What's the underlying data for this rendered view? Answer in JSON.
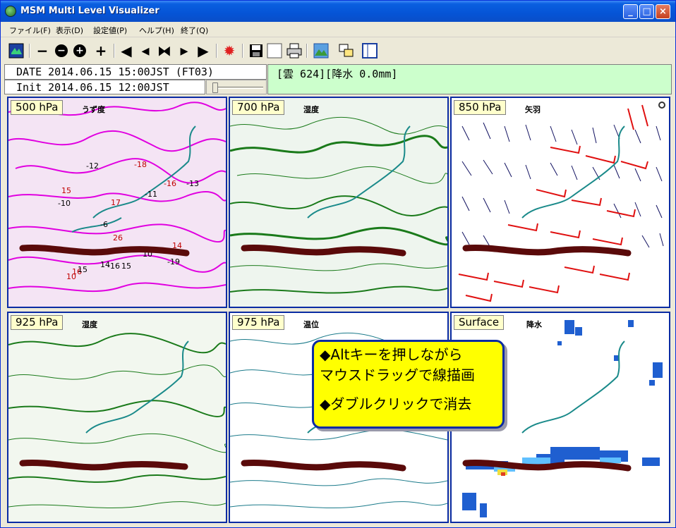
{
  "window": {
    "title": "MSM Multi Level Visualizer",
    "controls": [
      "_",
      "□",
      "×"
    ]
  },
  "menu": {
    "items": [
      "ファイル(F)",
      "表示(D)",
      "設定値(P)",
      "ヘルプ(H)",
      "終了(Q)"
    ]
  },
  "toolbar": {
    "tools": [
      {
        "name": "map-icon"
      },
      {
        "name": "zoom-out-small",
        "glyph": "−"
      },
      {
        "name": "zoom-out",
        "glyph": "−"
      },
      {
        "name": "zoom-in",
        "glyph": "+"
      },
      {
        "name": "zoom-in-small",
        "glyph": "+"
      },
      {
        "name": "first",
        "glyph": "◀"
      },
      {
        "name": "prev",
        "glyph": "◂"
      },
      {
        "name": "stop",
        "glyph": "⧓"
      },
      {
        "name": "next",
        "glyph": "▸"
      },
      {
        "name": "last",
        "glyph": "▶"
      },
      {
        "name": "sun-icon",
        "glyph": "✹"
      },
      {
        "name": "save-icon"
      },
      {
        "name": "blank-icon"
      },
      {
        "name": "print-icon"
      },
      {
        "name": "picture-icon"
      },
      {
        "name": "window-icon"
      },
      {
        "name": "layout-icon"
      }
    ]
  },
  "info": {
    "date": "DATE 2014.06.15 15:00JST (FT03)",
    "init": "Init 2014.06.15 12:00JST",
    "status": "[雲 624][降水 0.0mm]",
    "slider_position": 0
  },
  "panels": [
    {
      "level": "500 hPa",
      "variable": "うず度",
      "color": "#e000e0",
      "fill": "#f4e4f4"
    },
    {
      "level": "700 hPa",
      "variable": "湿度",
      "color": "#1a7a1a",
      "fill": "#eef5ee"
    },
    {
      "level": "850 hPa",
      "variable": "矢羽",
      "color": "#101060",
      "fill": "#ffffff"
    },
    {
      "level": "925 hPa",
      "variable": "湿度",
      "color": "#1a7a1a",
      "fill": "#f2f7ef"
    },
    {
      "level": "975 hPa",
      "variable": "温位",
      "color": "#1a7a8a",
      "fill": "#ffffff"
    },
    {
      "level": "Surface",
      "variable": "降水",
      "color": "#1f5fd0",
      "fill": "#ffffff"
    }
  ],
  "vorticity_labels": [
    "-12",
    "-18",
    "15",
    "-10",
    "17",
    "-11",
    "-16",
    "-13",
    "-6",
    "26",
    "14",
    "10",
    "-19",
    "16",
    "14",
    "-16",
    "15",
    "10",
    "15"
  ],
  "callout": {
    "line1": "◆Altキーを押しながら",
    "line2": "マウスドラッグで線描画",
    "line3": "◆ダブルクリックで消去"
  },
  "colors": {
    "frontline": "#5a0a0a",
    "coastline": "#1a8a8a",
    "panel_border": "#0a2ba3",
    "callout_bg": "#ffff00"
  }
}
